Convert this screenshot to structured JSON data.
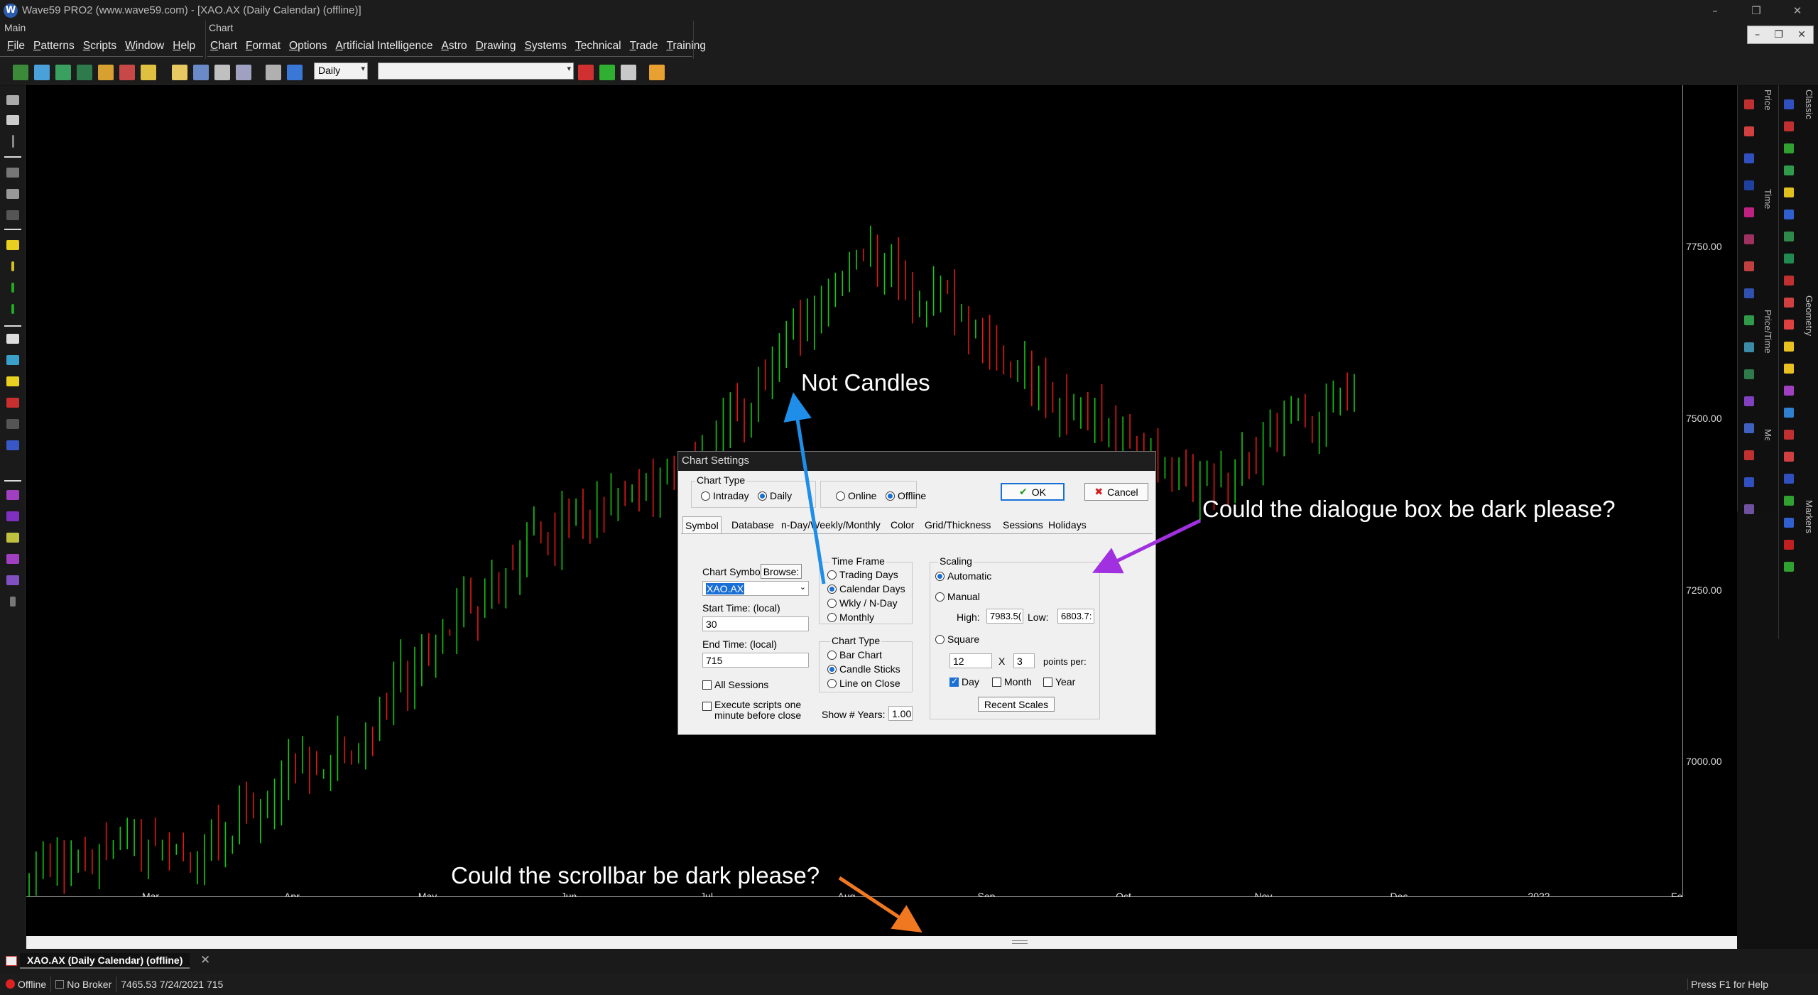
{
  "window": {
    "title": "Wave59 PRO2 (www.wave59.com) - [XAO.AX (Daily Calendar) (offline)]",
    "logo_letter": "W",
    "controls": [
      "–",
      "❐",
      "✕"
    ]
  },
  "menus": {
    "main_group_label": "Main",
    "chart_group_label": "Chart",
    "main_items": [
      {
        "first": "F",
        "rest": "ile"
      },
      {
        "first": "P",
        "rest": "atterns"
      },
      {
        "first": "S",
        "rest": "cripts"
      },
      {
        "first": "W",
        "rest": "indow"
      },
      {
        "first": "H",
        "rest": "elp"
      }
    ],
    "chart_items": [
      {
        "first": "C",
        "rest": "hart"
      },
      {
        "first": "F",
        "rest": "ormat"
      },
      {
        "first": "O",
        "rest": "ptions"
      },
      {
        "first": "A",
        "rest": "rtificial Intelligence"
      },
      {
        "first": "A",
        "rest": "stro"
      },
      {
        "first": "D",
        "rest": "rawing"
      },
      {
        "first": "S",
        "rest": "ystems"
      },
      {
        "first": "T",
        "rest": "echnical"
      },
      {
        "first": "T",
        "rest": "rade"
      },
      {
        "first": "T",
        "rest": "raining"
      }
    ]
  },
  "toolbar": {
    "timeframe_value": "Daily",
    "symbol_value": "",
    "mdi_controls": [
      "–",
      "❐",
      "✕"
    ]
  },
  "right_panels": {
    "price": "Price",
    "time": "Time",
    "price_time": "Price/Time",
    "measuring": "Measuring",
    "classic": "Classic",
    "geometry": "Geometry",
    "markers": "Markers"
  },
  "chart_data": {
    "type": "bar",
    "symbol": "XAO.AX",
    "x_tick_labels": [
      "Mar",
      "Apr",
      "May",
      "Jun",
      "Jul",
      "Aug",
      "Sep",
      "Oct",
      "Nov",
      "Dec",
      "2022",
      "Feb"
    ],
    "y_tick_labels": [
      "7750.00",
      "7500.00",
      "7250.00",
      "7000.00"
    ],
    "y_ticks": [
      7750,
      7500,
      7250,
      7000
    ],
    "ylim": [
      6800,
      8100
    ],
    "bar_colors": {
      "up": "#14c814",
      "down": "#e01818"
    },
    "approx_closes_by_month": [
      {
        "month": "Mar",
        "close": 6980
      },
      {
        "month": "Apr",
        "close": 7010
      },
      {
        "month": "May",
        "close": 7180
      },
      {
        "month": "Jun",
        "close": 7450
      },
      {
        "month": "Jul",
        "close": 7560
      },
      {
        "month": "Aug",
        "close": 7870
      },
      {
        "month": "Sep",
        "close": 7680
      },
      {
        "month": "Oct",
        "close": 7520
      },
      {
        "month": "Nov",
        "close": 7690
      }
    ]
  },
  "dialog": {
    "title": "Chart Settings",
    "chart_type_legend": "Chart Type",
    "intraday": "Intraday",
    "daily": "Daily",
    "online": "Online",
    "offline": "Offline",
    "ok": "OK",
    "cancel": "Cancel",
    "tabs": [
      "Symbol",
      "Database",
      "n-Day/Weekly/Monthly",
      "Color",
      "Grid/Thickness",
      "Sessions",
      "Holidays"
    ],
    "chart_symbol_label": "Chart Symbol:",
    "browse": "Browse:",
    "symbol_value": "XAO.AX",
    "start_time_label": "Start Time: (local)",
    "start_time_value": "30",
    "end_time_label": "End Time: (local)",
    "end_time_value": "715",
    "all_sessions": "All Sessions",
    "execute_scripts_line1": "Execute scripts one",
    "execute_scripts_line2": "minute before close",
    "time_frame_legend": "Time Frame",
    "trading_days": "Trading Days",
    "calendar_days": "Calendar Days",
    "wkly_nday": "Wkly / N-Day",
    "monthly": "Monthly",
    "chart_type2_legend": "Chart Type",
    "bar_chart": "Bar Chart",
    "candle_sticks": "Candle Sticks",
    "line_on_close": "Line on Close",
    "show_years_label": "Show # Years:",
    "show_years_value": "1.00",
    "scaling_legend": "Scaling",
    "automatic": "Automatic",
    "manual": "Manual",
    "high_label": "High:",
    "high_value": "7983.5(",
    "low_label": "Low:",
    "low_value": "6803.7:",
    "square": "Square",
    "square_value_1": "12",
    "times": "X",
    "square_value_2": "3",
    "points_per": "points per:",
    "day": "Day",
    "month": "Month",
    "year": "Year",
    "recent_scales": "Recent Scales"
  },
  "bottom": {
    "doc_tab_label": "XAO.AX (Daily Calendar) (offline)",
    "doc_tab_close": "✕",
    "status_offline": "Offline",
    "status_broker": "No Broker",
    "status_price": "7465.53",
    "status_date": "7/24/2021",
    "status_time": "715",
    "status_help": "Press F1 for Help"
  },
  "annotations": {
    "not_candles": "Not Candles",
    "dialog_dark": "Could the dialogue box be dark please?",
    "scrollbar_dark": "Could the scrollbar be dark please?",
    "colors": {
      "blue": "#1e8ee8",
      "purple": "#a030e0",
      "orange": "#f07820"
    }
  }
}
